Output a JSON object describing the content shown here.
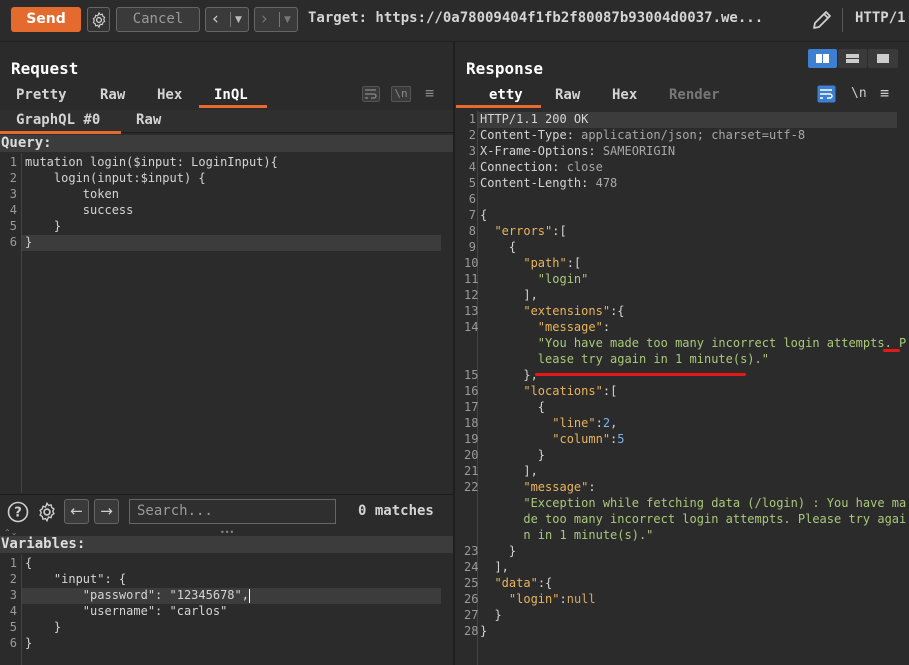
{
  "toolbar": {
    "send_label": "Send",
    "cancel_label": "Cancel",
    "back_icon": "‹",
    "forward_icon": "›",
    "target_text": "Target: https://0a78009404f1fb2f80087b93004d0037.we...",
    "http_text": "HTTP/1"
  },
  "request": {
    "title": "Request",
    "tabs": [
      "Pretty",
      "Raw",
      "Hex",
      "InQL"
    ],
    "active_tab": "InQL",
    "subtabs": [
      "GraphQL #0",
      "Raw"
    ],
    "query_label": "Query:",
    "query_lines": [
      "mutation login($input: LoginInput){",
      "    login(input:$input) {",
      "        token",
      "        success",
      "    }",
      "}"
    ],
    "search_placeholder": "Search...",
    "matches_text": "0 matches",
    "variables_label": "Variables:",
    "variables_lines": [
      "{",
      "    \"input\": {",
      "        \"password\": \"12345678\",",
      "        \"username\": \"carlos\"",
      "    }",
      "}"
    ]
  },
  "response": {
    "title": "Response",
    "tabs": [
      "etty",
      "Raw",
      "Hex",
      "Render"
    ],
    "active_tab": "etty",
    "lines": [
      {
        "n": "1",
        "t": "HTTP/1.1 200 OK"
      },
      {
        "n": "2",
        "t": "Content-Type: application/json; charset=utf-8"
      },
      {
        "n": "3",
        "t": "X-Frame-Options: SAMEORIGIN"
      },
      {
        "n": "4",
        "t": "Connection: close"
      },
      {
        "n": "5",
        "t": "Content-Length: 478"
      },
      {
        "n": "6",
        "t": ""
      },
      {
        "n": "7",
        "t": "{"
      },
      {
        "n": "8",
        "t": "  \"errors\":["
      },
      {
        "n": "9",
        "t": "    {"
      },
      {
        "n": "10",
        "t": "      \"path\":["
      },
      {
        "n": "11",
        "t": "        \"login\""
      },
      {
        "n": "12",
        "t": "      ],"
      },
      {
        "n": "13",
        "t": "      \"extensions\":{"
      },
      {
        "n": "14",
        "t": "        \"message\":"
      },
      {
        "n": "",
        "t": "        \"You have made too many incorrect login attempts. P"
      },
      {
        "n": "",
        "t": "        lease try again in 1 minute(s).\""
      },
      {
        "n": "15",
        "t": "      },"
      },
      {
        "n": "16",
        "t": "      \"locations\":["
      },
      {
        "n": "17",
        "t": "        {"
      },
      {
        "n": "18",
        "t": "          \"line\":2,"
      },
      {
        "n": "19",
        "t": "          \"column\":5"
      },
      {
        "n": "20",
        "t": "        }"
      },
      {
        "n": "21",
        "t": "      ],"
      },
      {
        "n": "22",
        "t": "      \"message\":"
      },
      {
        "n": "",
        "t": "      \"Exception while fetching data (/login) : You have ma"
      },
      {
        "n": "",
        "t": "      de too many incorrect login attempts. Please try agai"
      },
      {
        "n": "",
        "t": "      n in 1 minute(s).\""
      },
      {
        "n": "23",
        "t": "    }"
      },
      {
        "n": "24",
        "t": "  ],"
      },
      {
        "n": "25",
        "t": "  \"data\":{"
      },
      {
        "n": "26",
        "t": "    \"login\":null"
      },
      {
        "n": "27",
        "t": "  }"
      },
      {
        "n": "28",
        "t": "}"
      }
    ]
  },
  "colors": {
    "accent": "#e46a2e",
    "layout_active": "#3d7fd1",
    "annotation_red": "#e41818"
  }
}
